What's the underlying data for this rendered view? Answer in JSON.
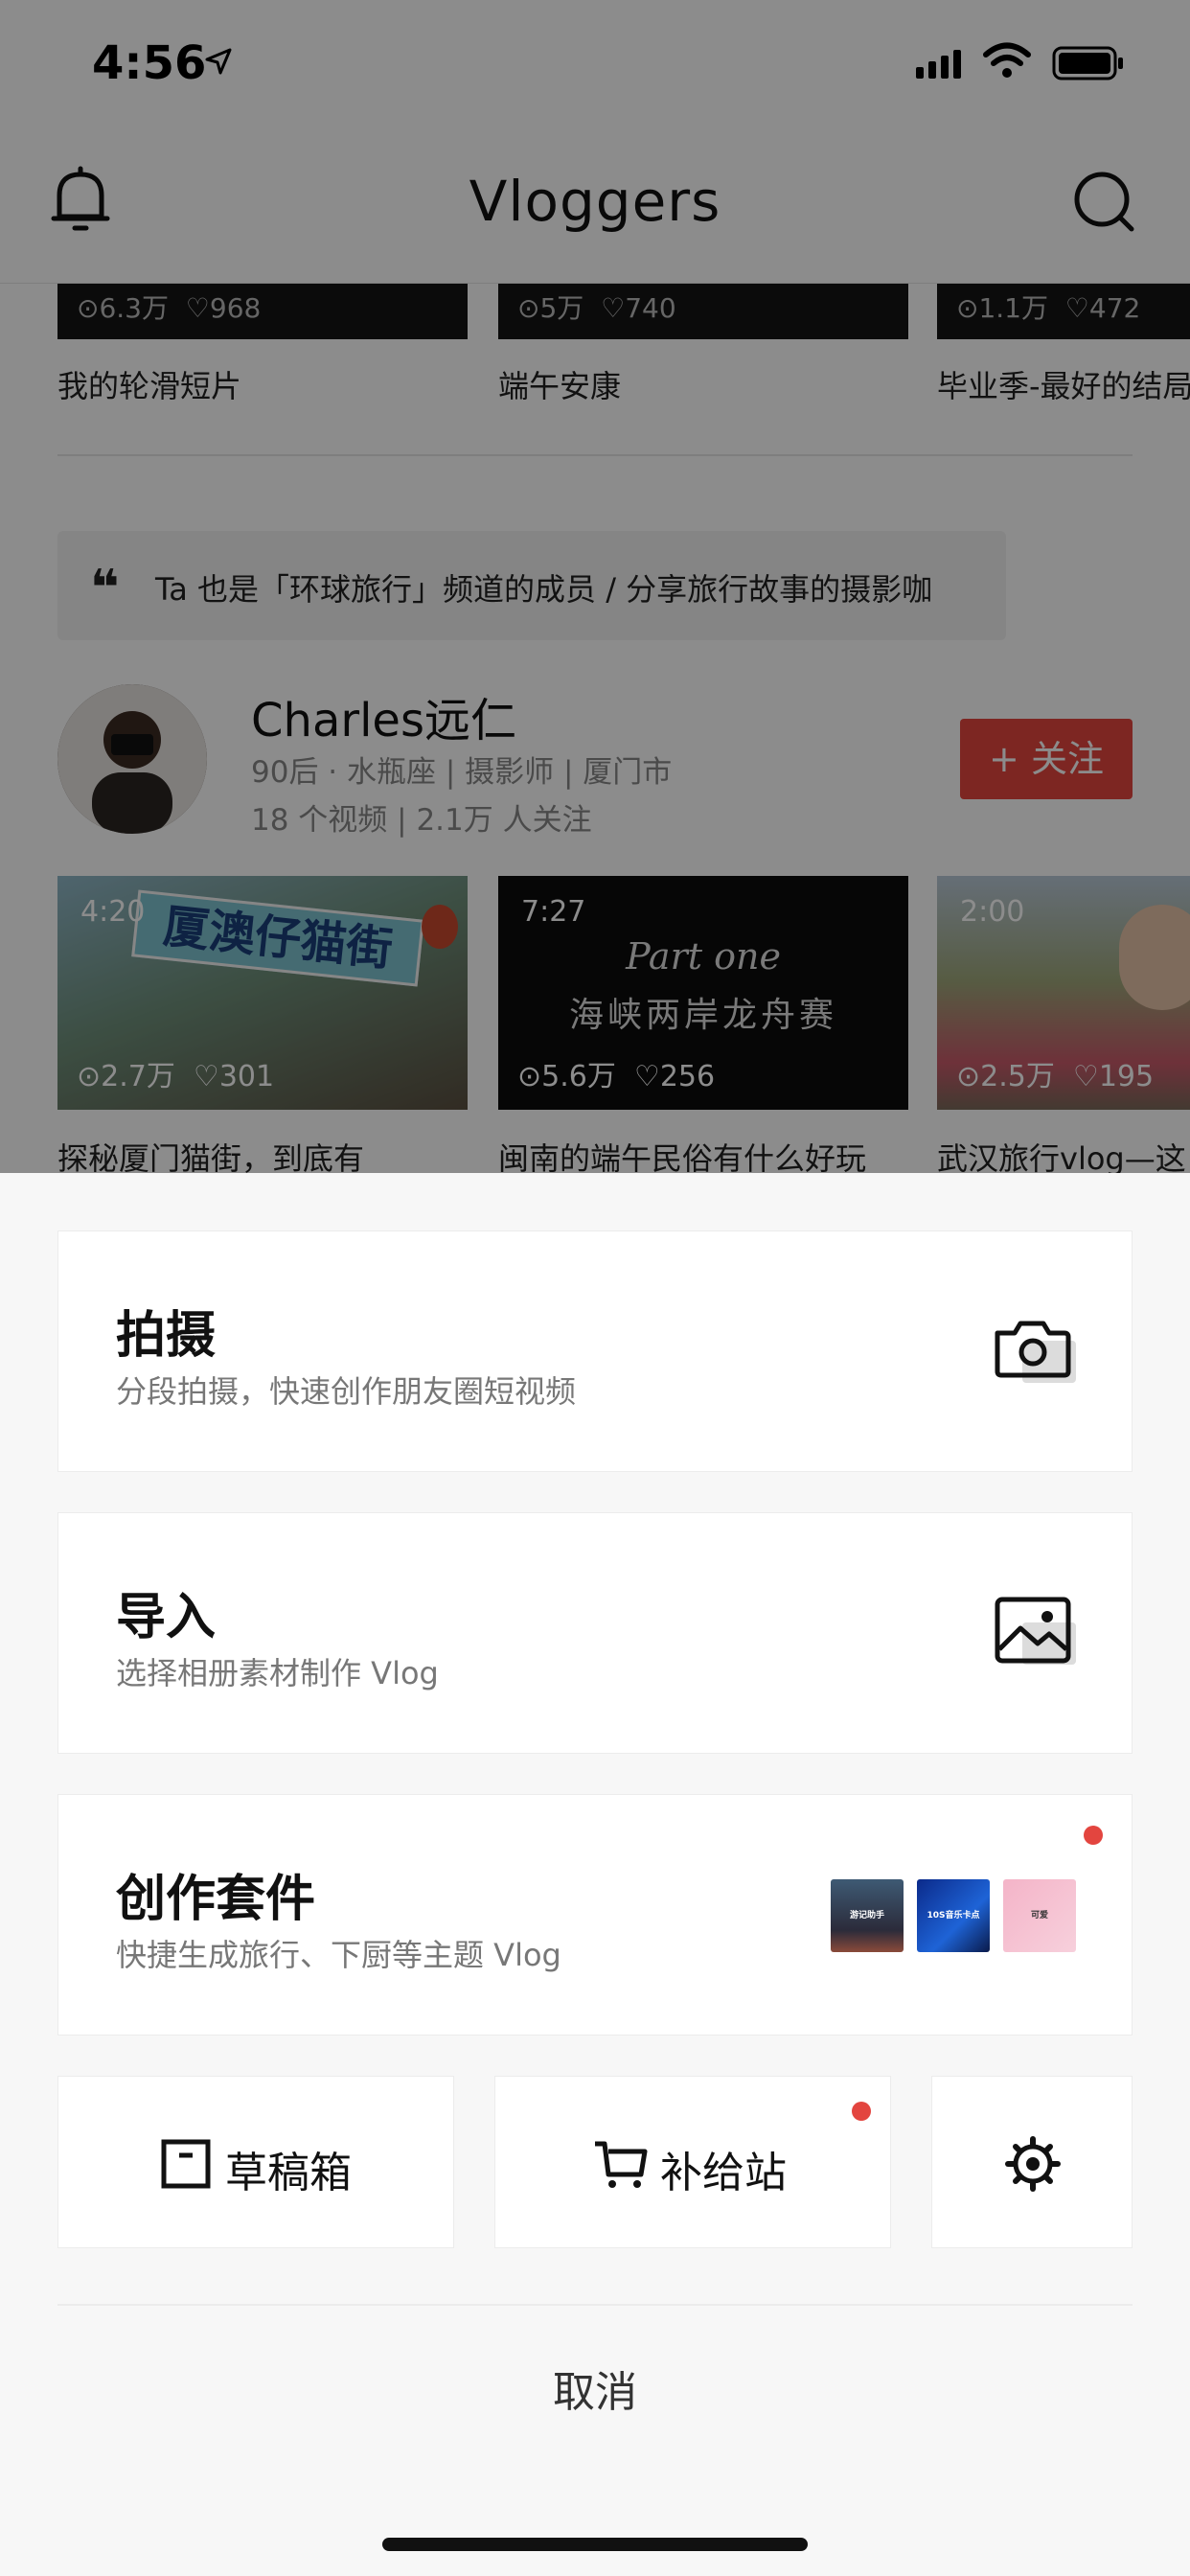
{
  "status_bar": {
    "time": "4:56"
  },
  "nav": {
    "title": "Vloggers"
  },
  "top_row": [
    {
      "views": "6.3万",
      "likes": "968",
      "caption": "我的轮滑短片"
    },
    {
      "views": "5万",
      "likes": "740",
      "caption": "端午安康"
    },
    {
      "views": "1.1万",
      "likes": "472",
      "caption": "毕业季-最好的结局"
    }
  ],
  "member_quote": "Ta 也是「环球旅行」频道的成员 / 分享旅行故事的摄影咖",
  "creator": {
    "name": "Charles远仁",
    "desc": "90后 · 水瓶座 | 摄影师 | 厦门市",
    "stats": "18 个视频 | 2.1万 人关注",
    "follow_label": "+ 关注"
  },
  "videos": [
    {
      "duration": "4:20",
      "views": "2.7万",
      "likes": "301",
      "caption": "探秘厦门猫街，到底有",
      "thumb_text": "厦澳仔猫街"
    },
    {
      "duration": "7:27",
      "views": "5.6万",
      "likes": "256",
      "caption": "闽南的端午民俗有什么好玩",
      "thumb_line1": "Part one",
      "thumb_line2": "海峡两岸龙舟赛"
    },
    {
      "duration": "2:00",
      "views": "2.5万",
      "likes": "195",
      "caption": "武汉旅行vlog—这"
    }
  ],
  "sheet": {
    "shoot": {
      "title": "拍摄",
      "subtitle": "分段拍摄，快速创作朋友圈短视频"
    },
    "import": {
      "title": "导入",
      "subtitle": "选择相册素材制作 Vlog"
    },
    "kit": {
      "title": "创作套件",
      "subtitle": "快捷生成旅行、下厨等主题 Vlog",
      "thumbs": [
        "游记助手",
        "10S音乐卡点",
        "可爱"
      ]
    },
    "drafts_label": "草稿箱",
    "supply_label": "补给站",
    "cancel_label": "取消"
  },
  "colors": {
    "accent_red": "#e3453f",
    "sheet_bg": "#f7f7f7"
  },
  "icons": [
    "bell-icon",
    "search-icon",
    "camera-icon",
    "image-icon",
    "draft-box-icon",
    "cart-icon",
    "settings-gear-icon"
  ]
}
